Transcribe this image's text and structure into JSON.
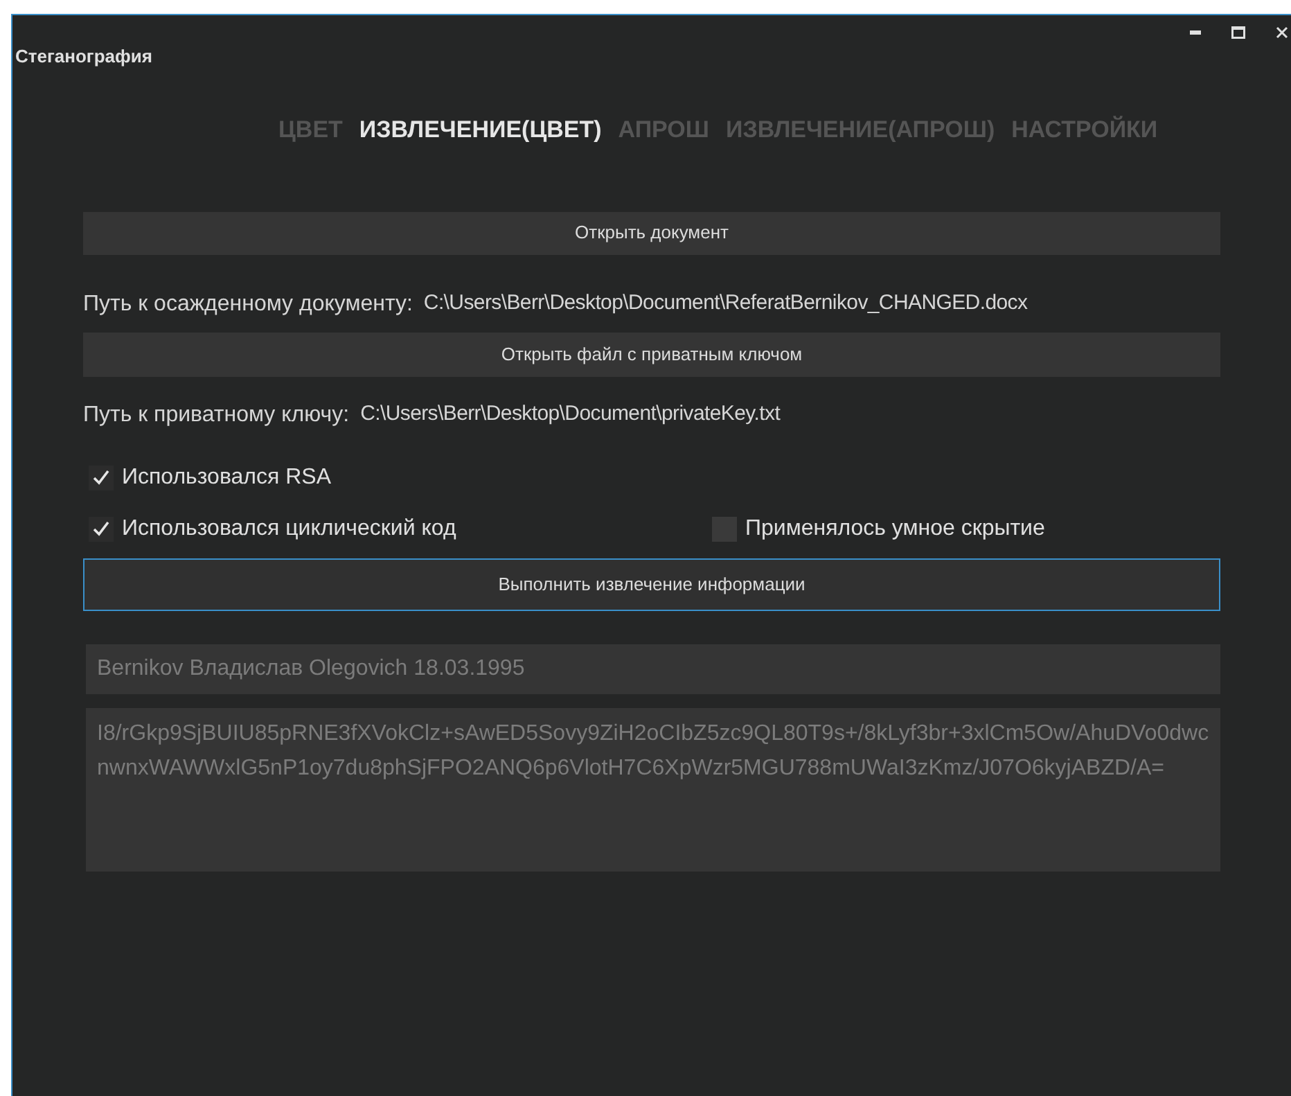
{
  "window": {
    "title": "Стеганография"
  },
  "tabs": [
    {
      "label": "ЦВЕТ",
      "selected": false
    },
    {
      "label": "ИЗВЛЕЧЕНИЕ(ЦВЕТ)",
      "selected": true
    },
    {
      "label": "АПРОШ",
      "selected": false
    },
    {
      "label": "ИЗВЛЕЧЕНИЕ(АПРОШ)",
      "selected": false
    },
    {
      "label": "НАСТРОЙКИ",
      "selected": false
    }
  ],
  "open_document_button": "Открыть документ",
  "document_path": {
    "label": "Путь к осажденному документу:",
    "value": "C:\\Users\\Berr\\Desktop\\Document\\ReferatBernikov_CHANGED.docx"
  },
  "open_key_button": "Открыть файл с приватным ключом",
  "key_path": {
    "label": "Путь к приватному ключу:",
    "value": "C:\\Users\\Berr\\Desktop\\Document\\privateKey.txt"
  },
  "checkboxes": [
    {
      "label": "Использовался RSA",
      "checked": true
    },
    {
      "label": "Использовался циклический код",
      "checked": true
    },
    {
      "label": "Применялось умное скрытие",
      "checked": false
    }
  ],
  "extract_button": {
    "label": "Выполнить извлечение информации",
    "focused": true
  },
  "result_field": {
    "value": "Bernikov Владислав Olegovich 18.03.1995"
  },
  "result_text": {
    "value": "I8/rGkp9SjBUIU85pRNE3fXVokClz+sAwED5Sovy9ZiH2oCIbZ5zc9QL80T9s+/8kLyf3br+3xlCm5Ow/AhuDVo0dwcnwnxWAWWxlG5nP1oy7du8phSjFPO2ANQ6p6VlotH7C6XpWzr5MGU788mUWaI3zKmz/J07O6kyjABZD/A="
  }
}
